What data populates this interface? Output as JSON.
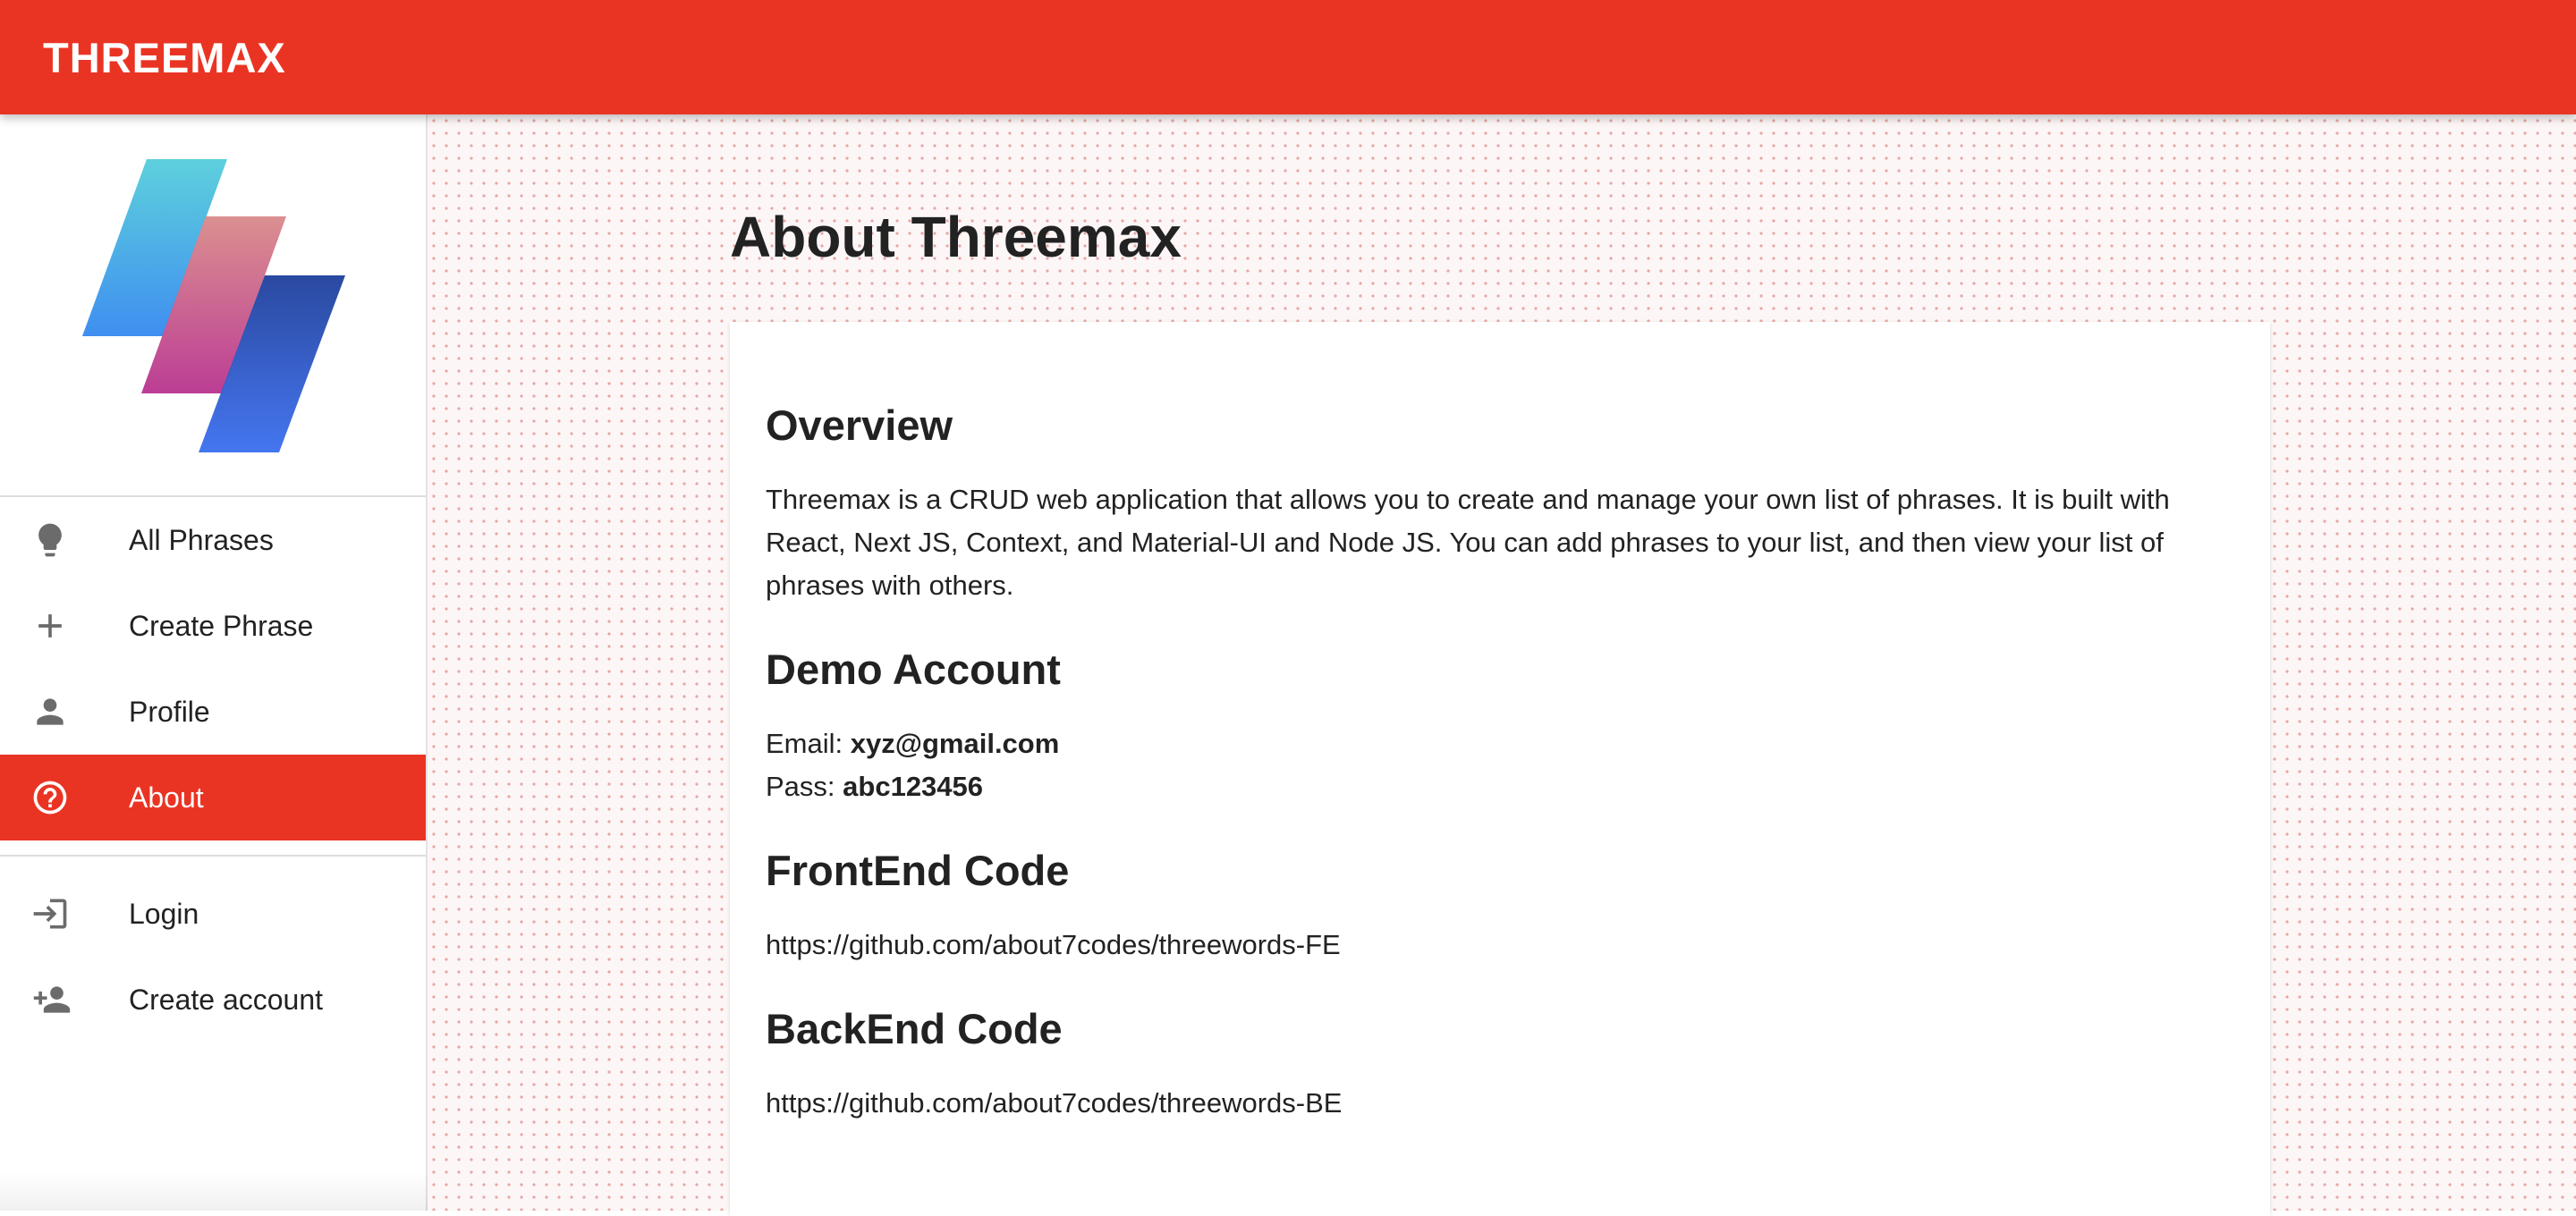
{
  "app": {
    "title": "THREEMAX",
    "brand_color": "#ea3423"
  },
  "sidebar": {
    "logo": "threemax-logo",
    "primary_items": [
      {
        "label": "All Phrases",
        "icon": "lightbulb-icon",
        "active": false
      },
      {
        "label": "Create Phrase",
        "icon": "plus-icon",
        "active": false
      },
      {
        "label": "Profile",
        "icon": "person-icon",
        "active": false
      },
      {
        "label": "About",
        "icon": "help-circle-icon",
        "active": true
      }
    ],
    "secondary_items": [
      {
        "label": "Login",
        "icon": "login-icon",
        "active": false
      },
      {
        "label": "Create account",
        "icon": "person-add-icon",
        "active": false
      }
    ]
  },
  "main": {
    "page_title": "About Threemax",
    "overview": {
      "heading": "Overview",
      "text": "Threemax is a CRUD web application that allows you to create and manage your own list of phrases. It is built with React, Next JS, Context, and Material-UI and Node JS. You can add phrases to your list, and then view your list of phrases with others."
    },
    "demo_account": {
      "heading": "Demo Account",
      "email_label": "Email:",
      "email_value": "xyz@gmail.com",
      "pass_label": "Pass:",
      "pass_value": "abc123456"
    },
    "frontend": {
      "heading": "FrontEnd Code",
      "url": "https://github.com/about7codes/threewords-FE"
    },
    "backend": {
      "heading": "BackEnd Code",
      "url": "https://github.com/about7codes/threewords-BE"
    }
  }
}
